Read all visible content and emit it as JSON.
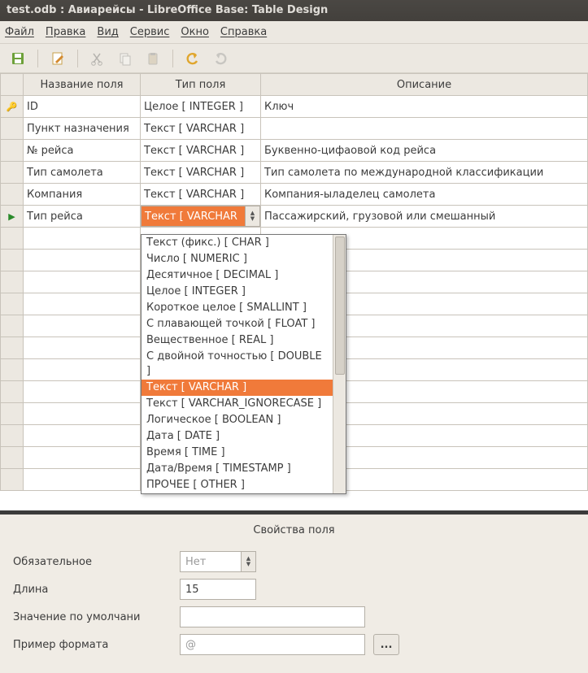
{
  "title": "test.odb : Авиарейсы - LibreOffice Base: Table Design",
  "menu": {
    "file": "Файл",
    "edit": "Правка",
    "view": "Вид",
    "tools": "Сервис",
    "window": "Окно",
    "help": "Справка"
  },
  "columns": {
    "name": "Название поля",
    "type": "Тип поля",
    "desc": "Описание"
  },
  "rows": [
    {
      "name": "ID",
      "type": "Целое [ INTEGER ]",
      "desc": "Ключ",
      "marker": "key"
    },
    {
      "name": "Пункт назначения",
      "type": "Текст [ VARCHAR ]",
      "desc": ""
    },
    {
      "name": "№ рейса",
      "type": "Текст [ VARCHAR ]",
      "desc": "Буквенно-цифаовой код рейса"
    },
    {
      "name": "Тип самолета",
      "type": "Текст [ VARCHAR ]",
      "desc": "Тип самолета по международной классификации"
    },
    {
      "name": "Компания",
      "type": "Текст [ VARCHAR ]",
      "desc": "Компания-ыладелец самолета"
    },
    {
      "name": "Тип рейса",
      "type": "Текст [ VARCHAR",
      "desc": "Пассажирский, грузовой или смешанный",
      "marker": "current",
      "editing": true
    }
  ],
  "emptyRows": 12,
  "dropdown": {
    "items": [
      "Текст (фикс.) [ CHAR ]",
      "Число [ NUMERIC ]",
      "Десятичное [ DECIMAL ]",
      "Целое [ INTEGER ]",
      "Короткое целое [ SMALLINT ]",
      "С плавающей точкой [ FLOAT ]",
      "Вещественное [ REAL ]",
      "С двойной точностью [ DOUBLE ]",
      "Текст [ VARCHAR ]",
      "Текст [ VARCHAR_IGNORECASE ]",
      "Логическое [ BOOLEAN ]",
      "Дата [ DATE ]",
      "Время [ TIME ]",
      "Дата/Время [ TIMESTAMP ]",
      "ПРОЧЕЕ [ OTHER ]"
    ],
    "selected": 8
  },
  "props": {
    "title": "Свойства поля",
    "required_label": "Обязательное",
    "required_value": "Нет",
    "length_label": "Длина",
    "length_value": "15",
    "default_label": "Значение по умолчани",
    "default_value": "",
    "format_label": "Пример формата",
    "format_value": "@",
    "format_btn": "..."
  }
}
